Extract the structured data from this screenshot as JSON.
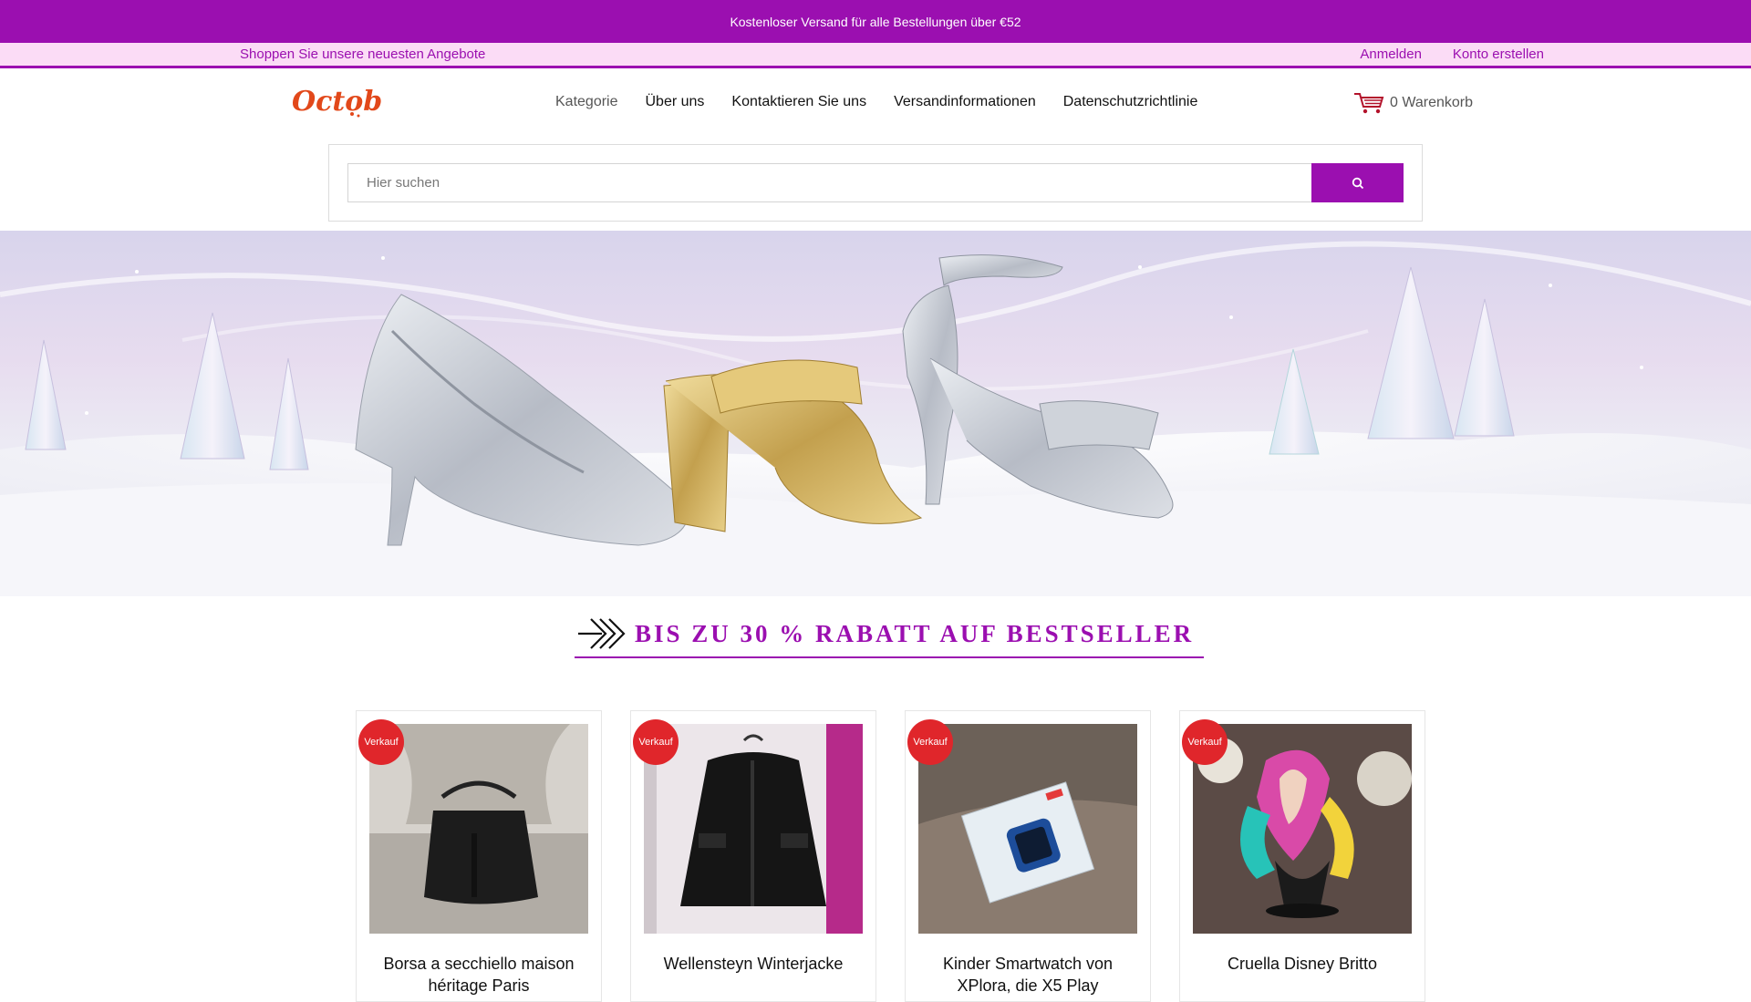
{
  "topbar": {
    "text": "Kostenloser Versand für alle Bestellungen über €52"
  },
  "subbar": {
    "left": "Shoppen Sie unsere neuesten Angebote",
    "login": "Anmelden",
    "register": "Konto erstellen"
  },
  "brand": {
    "logo_text": "October"
  },
  "nav": {
    "items": [
      "Kategorie",
      "Über uns",
      "Kontaktieren Sie uns",
      "Versandinformationen",
      "Datenschutzrichtlinie"
    ]
  },
  "cart": {
    "label": "0 Warenkorb",
    "icon": "cart-icon"
  },
  "search": {
    "placeholder": "Hier suchen",
    "icon": "search-icon"
  },
  "promo": {
    "text": "BIS ZU 30 % RABATT AUF BESTSELLER",
    "icon": "double-chevron-right-icon"
  },
  "products": [
    {
      "badge": "Verkauf",
      "title": "Borsa a secchiello maison héritage Paris"
    },
    {
      "badge": "Verkauf",
      "title": "Wellensteyn Winterjacke"
    },
    {
      "badge": "Verkauf",
      "title": "Kinder Smartwatch von XPlora, die X5 Play"
    },
    {
      "badge": "Verkauf",
      "title": "Cruella Disney Britto"
    }
  ],
  "colors": {
    "brand": "#9b0fb0",
    "subbar_bg": "#fbdcf6",
    "badge": "#e0262b",
    "logo": "#e2481a"
  }
}
